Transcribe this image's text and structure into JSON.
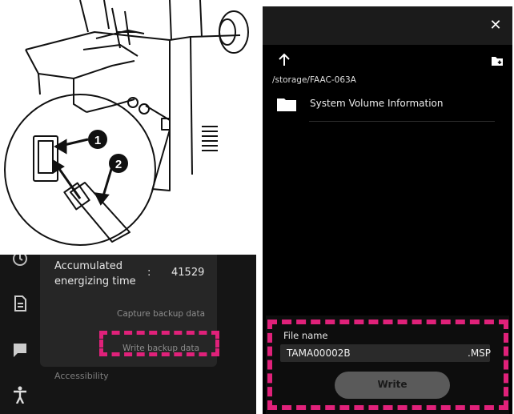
{
  "illustration": {
    "callouts": [
      {
        "label": "1"
      },
      {
        "label": "2"
      }
    ]
  },
  "settings": {
    "accumulated_label": "Accumulated energizing time",
    "colon": ":",
    "accumulated_value": "41529",
    "capture_backup": "Capture backup data",
    "write_backup": "Write backup data",
    "accessibility": "Accessibility",
    "rail_icons": [
      "history-icon",
      "document-icon",
      "message-icon",
      "accessibility-icon"
    ]
  },
  "file_dialog": {
    "close_icon": "close-icon",
    "up_icon": "arrow-up-icon",
    "new_folder_icon": "new-folder-icon",
    "path": "/storage/FAAC-063A",
    "folders": [
      {
        "name": "System Volume Information",
        "icon": "folder-icon"
      }
    ],
    "file_name_label": "File name",
    "file_name_value": "TAMA00002B",
    "extension": ".MSP",
    "write_label": "Write"
  },
  "colors": {
    "highlight": "#e0217a",
    "phone_bg": "#000000",
    "button_bg": "#5a5a5a"
  }
}
